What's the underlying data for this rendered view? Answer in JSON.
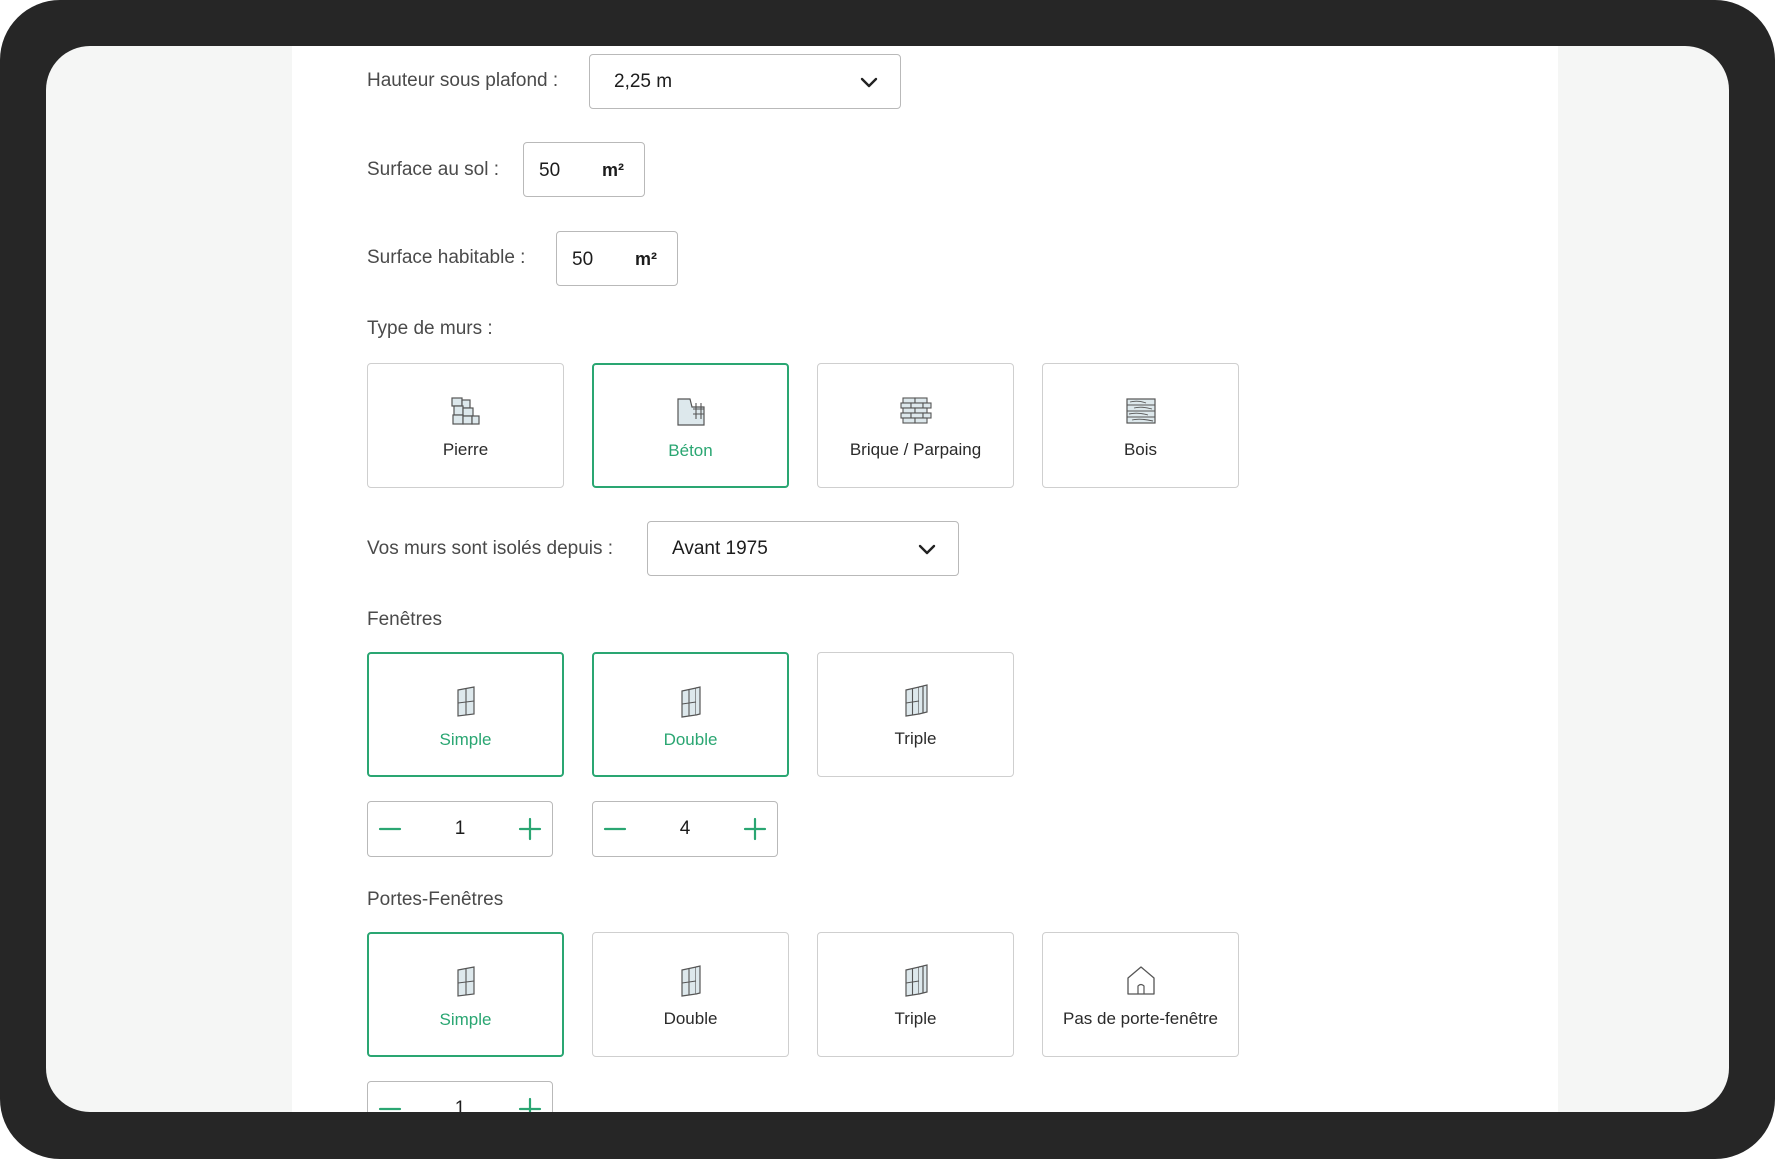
{
  "form": {
    "ceiling": {
      "label": "Hauteur sous plafond :",
      "value": "2,25 m"
    },
    "floor_area": {
      "label": "Surface au sol :",
      "value": "50",
      "unit": "m²"
    },
    "living_area": {
      "label": "Surface habitable :",
      "value": "50",
      "unit": "m²"
    },
    "walls": {
      "label": "Type de murs :",
      "options": [
        {
          "label": "Pierre",
          "icon": "stone-wall-icon",
          "selected": false
        },
        {
          "label": "Béton",
          "icon": "concrete-wall-icon",
          "selected": true
        },
        {
          "label": "Brique / Parpaing",
          "icon": "brick-wall-icon",
          "selected": false
        },
        {
          "label": "Bois",
          "icon": "wood-wall-icon",
          "selected": false
        }
      ]
    },
    "insulation": {
      "label": "Vos murs sont isolés depuis :",
      "value": "Avant 1975"
    },
    "windows": {
      "label": "Fenêtres",
      "options": [
        {
          "label": "Simple",
          "icon": "single-window-icon",
          "selected": true
        },
        {
          "label": "Double",
          "icon": "double-window-icon",
          "selected": true
        },
        {
          "label": "Triple",
          "icon": "triple-window-icon",
          "selected": false
        }
      ],
      "counts": [
        "1",
        "4"
      ]
    },
    "french_windows": {
      "label": "Portes-Fenêtres",
      "options": [
        {
          "label": "Simple",
          "icon": "single-window-icon",
          "selected": true
        },
        {
          "label": "Double",
          "icon": "double-window-icon",
          "selected": false
        },
        {
          "label": "Triple",
          "icon": "triple-window-icon",
          "selected": false
        },
        {
          "label": "Pas de porte-fenêtre",
          "icon": "house-icon",
          "selected": false
        }
      ],
      "counts": [
        "1"
      ]
    }
  },
  "colors": {
    "accent": "#2aa672",
    "bezel": "#262626"
  }
}
